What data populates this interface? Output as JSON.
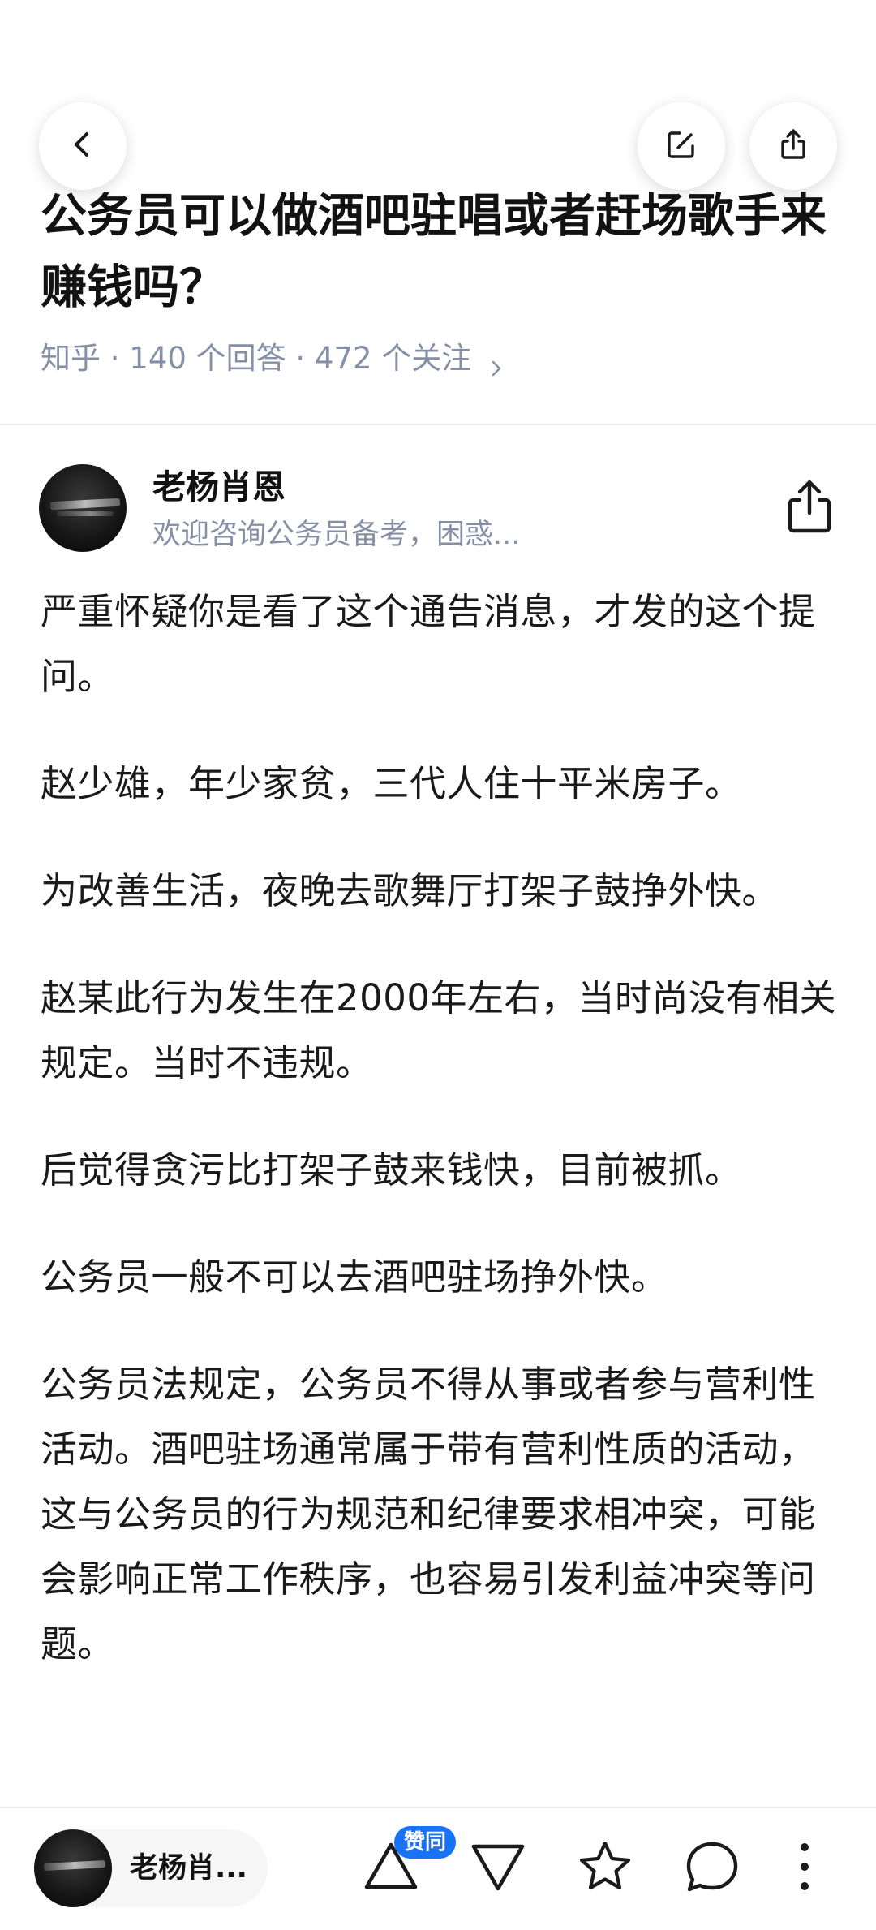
{
  "question": {
    "title": "公务员可以做酒吧驻唱或者赶场歌手来赚钱吗？",
    "meta": "知乎 · 140 个回答 · 472 个关注"
  },
  "answer": {
    "author_name": "老杨肖恩",
    "author_bio": "欢迎咨询公务员备考，困惑...",
    "paragraphs": [
      "严重怀疑你是看了这个通告消息，才发的这个提问。",
      "赵少雄，年少家贫，三代人住十平米房子。",
      "为改善生活，夜晚去歌舞厅打架子鼓挣外快。",
      "赵某此行为发生在2000年左右，当时尚没有相关规定。当时不违规。",
      "后觉得贪污比打架子鼓来钱快，目前被抓。",
      "公务员一般不可以去酒吧驻场挣外快。",
      "公务员法规定，公务员不得从事或者参与营利性活动。酒吧驻场通常属于带有营利性质的活动，这与公务员的行为规范和纪律要求相冲突，可能会影响正常工作秩序，也容易引发利益冲突等问题。"
    ]
  },
  "bottom_bar": {
    "author_short": "老杨肖...",
    "upvote_badge": "赞同"
  },
  "icons": {
    "back": "chevron-left-icon",
    "edit": "edit-icon",
    "share": "share-icon",
    "upvote": "triangle-up-icon",
    "downvote": "triangle-down-icon",
    "favorite": "star-icon",
    "comment": "comment-bubble-icon",
    "more": "more-vertical-icon"
  },
  "colors": {
    "accent": "#1772f6",
    "meta_gray": "#8590a6",
    "text": "#1a1a1a"
  }
}
